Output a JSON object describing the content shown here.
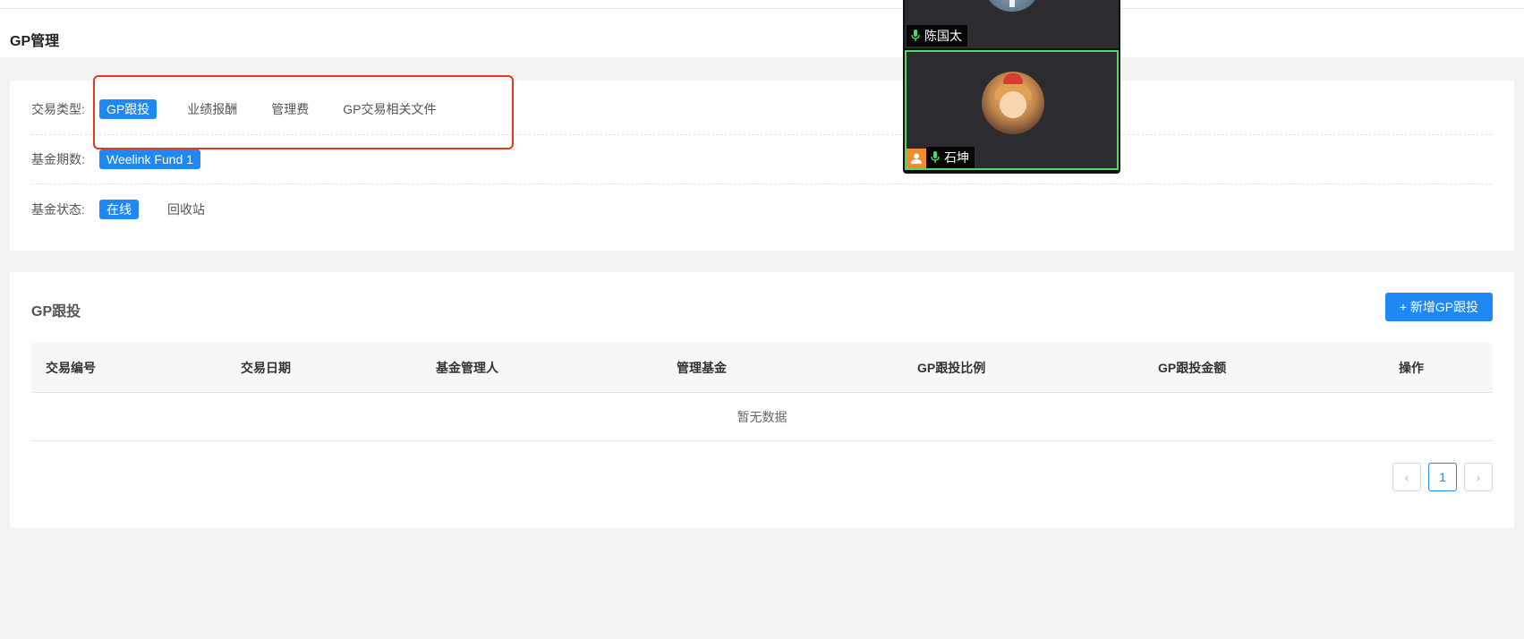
{
  "page": {
    "title": "GP管理"
  },
  "filters": {
    "transaction_type": {
      "label": "交易类型:",
      "options": [
        "GP跟投",
        "业绩报酬",
        "管理费",
        "GP交易相关文件"
      ],
      "selected": "GP跟投"
    },
    "fund_period": {
      "label": "基金期数:",
      "options": [
        "Weelink Fund 1"
      ],
      "selected": "Weelink Fund 1"
    },
    "fund_status": {
      "label": "基金状态:",
      "options": [
        "在线",
        "回收站"
      ],
      "selected": "在线"
    }
  },
  "table_section": {
    "title": "GP跟投",
    "add_button": "+ 新增GP跟投",
    "columns": [
      "交易编号",
      "交易日期",
      "基金管理人",
      "管理基金",
      "GP跟投比例",
      "GP跟投金额",
      "操作"
    ],
    "rows": [],
    "empty_text": "暂无数据",
    "pagination": {
      "prev": "‹",
      "current": "1",
      "next": "›"
    }
  },
  "video_call": {
    "participants": [
      {
        "name": "陈国太",
        "mic": "on"
      },
      {
        "name": "石坤",
        "mic": "on",
        "host": true,
        "speaking": true
      }
    ]
  },
  "colors": {
    "accent": "#1e88f5",
    "highlight": "#e4391b",
    "speaking": "#4cd964"
  }
}
